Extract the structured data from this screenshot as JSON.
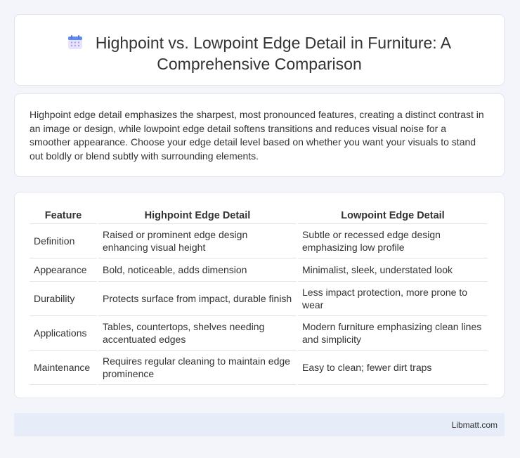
{
  "header": {
    "icon": "calendar-icon",
    "title": "Highpoint vs. Lowpoint Edge Detail in Furniture: A Comprehensive Comparison"
  },
  "intro": {
    "text": "Highpoint edge detail emphasizes the sharpest, most pronounced features, creating a distinct contrast in an image or design, while lowpoint edge detail softens transitions and reduces visual noise for a smoother appearance. Choose your edge detail level based on whether you want your visuals to stand out boldly or blend subtly with surrounding elements."
  },
  "table": {
    "headers": [
      "Feature",
      "Highpoint Edge Detail",
      "Lowpoint Edge Detail"
    ],
    "rows": [
      [
        "Definition",
        "Raised or prominent edge design enhancing visual height",
        "Subtle or recessed edge design emphasizing low profile"
      ],
      [
        "Appearance",
        "Bold, noticeable, adds dimension",
        "Minimalist, sleek, understated look"
      ],
      [
        "Durability",
        "Protects surface from impact, durable finish",
        "Less impact protection, more prone to wear"
      ],
      [
        "Applications",
        "Tables, countertops, shelves needing accentuated edges",
        "Modern furniture emphasizing clean lines and simplicity"
      ],
      [
        "Maintenance",
        "Requires regular cleaning to maintain edge prominence",
        "Easy to clean; fewer dirt traps"
      ]
    ]
  },
  "footer": {
    "brand": "Libmatt.com"
  }
}
